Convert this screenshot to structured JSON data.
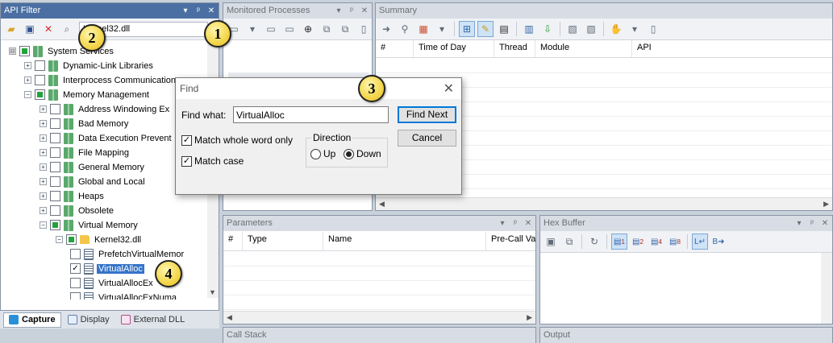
{
  "panes": {
    "api_filter": {
      "title": "API Filter",
      "search_value": "Kernel32.dll"
    },
    "monitored": {
      "title": "Monitored Processes"
    },
    "summary": {
      "title": "Summary",
      "columns": [
        "#",
        "Time of Day",
        "Thread",
        "Module",
        "API"
      ]
    },
    "parameters": {
      "title": "Parameters",
      "columns": [
        "#",
        "Type",
        "Name",
        "Pre-Call Val"
      ]
    },
    "hex_buffer": {
      "title": "Hex Buffer"
    },
    "call_stack": {
      "title": "Call Stack"
    },
    "output": {
      "title": "Output"
    }
  },
  "pane_buttons": {
    "dropdown": "▾",
    "pin": "ᵖ",
    "close": "✕"
  },
  "hex_toolbar": {
    "n1": "1",
    "n2": "2",
    "n4": "4",
    "n8": "8",
    "l": "L",
    "b": "B"
  },
  "tree": [
    {
      "label": "System Services",
      "expander": "⊟",
      "check": "partial"
    },
    {
      "label": "Dynamic-Link Libraries",
      "expander": "+",
      "check": "none"
    },
    {
      "label": "Interprocess Communications",
      "expander": "+",
      "check": "none"
    },
    {
      "label": "Memory Management",
      "expander": "−",
      "check": "partial"
    },
    {
      "label": "Address Windowing Ex",
      "expander": "+",
      "check": "none"
    },
    {
      "label": "Bad Memory",
      "expander": "+",
      "check": "none"
    },
    {
      "label": "Data Execution Prevent",
      "expander": "+",
      "check": "none"
    },
    {
      "label": "File Mapping",
      "expander": "+",
      "check": "none"
    },
    {
      "label": "General Memory",
      "expander": "+",
      "check": "none"
    },
    {
      "label": "Global and Local",
      "expander": "+",
      "check": "none"
    },
    {
      "label": "Heaps",
      "expander": "+",
      "check": "none"
    },
    {
      "label": "Obsolete",
      "expander": "+",
      "check": "none"
    },
    {
      "label": "Virtual Memory",
      "expander": "−",
      "check": "partial"
    },
    {
      "label": "Kernel32.dll",
      "expander": "−",
      "check": "partial"
    },
    {
      "label": "PrefetchVirtualMemor",
      "check": "none"
    },
    {
      "label": "VirtualAlloc",
      "check": "checked",
      "selected": true
    },
    {
      "label": "VirtualAllocEx",
      "check": "none"
    },
    {
      "label": "VirtualAllocExNuma",
      "check": "none"
    }
  ],
  "bottom_tabs": [
    "Capture",
    "Display",
    "External DLL"
  ],
  "find_dialog": {
    "title": "Find",
    "find_what_label": "Find what:",
    "find_what_value": "VirtualAlloc",
    "find_next_label": "Find Next",
    "cancel_label": "Cancel",
    "match_whole_word_label": "Match whole word only",
    "match_case_label": "Match case",
    "direction_label": "Direction",
    "up_label": "Up",
    "down_label": "Down"
  },
  "callouts": [
    "1",
    "2",
    "3",
    "4"
  ],
  "colors": {
    "title_active": "#4b6fa2",
    "selection": "#3574c9",
    "check_green": "#22a33c"
  }
}
